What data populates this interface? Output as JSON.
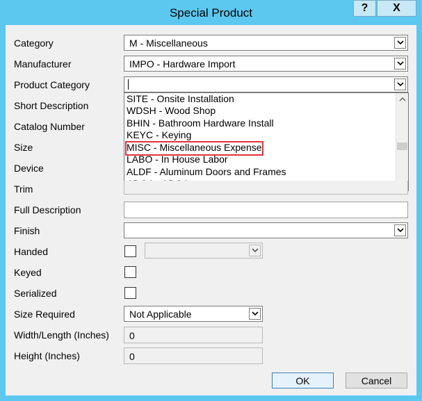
{
  "window": {
    "title": "Special Product",
    "help_glyph": "?",
    "close_glyph": "X"
  },
  "form": {
    "labels": {
      "category": "Category",
      "manufacturer": "Manufacturer",
      "product_category": "Product Category",
      "short_description": "Short Description",
      "catalog_number": "Catalog Number",
      "size": "Size",
      "device": "Device",
      "trim": "Trim",
      "full_description": "Full Description",
      "finish": "Finish",
      "handed": "Handed",
      "keyed": "Keyed",
      "serialized": "Serialized",
      "size_required": "Size Required",
      "width_length": "Width/Length (Inches)",
      "height": "Height (Inches)"
    },
    "values": {
      "category": "M - Miscellaneous",
      "manufacturer": "IMPO - Hardware Import",
      "product_category": "",
      "full_description": "",
      "finish": "",
      "handed_select": "",
      "size_required": "Not Applicable",
      "width_length": "0",
      "height": "0"
    },
    "checkboxes": {
      "handed": false,
      "keyed": false,
      "serialized": false
    }
  },
  "dropdown_list": {
    "items": [
      "SITE - Onsite Installation",
      "WDSH - Wood Shop",
      "BHIN - Bathroom Hardware Install",
      "KEYC - Keying",
      "MISC - Miscellaneous Expense",
      "LABO - In House Labor",
      "ALDF - Aluminum Doors and Frames",
      "ADOA - ADOA"
    ],
    "highlighted_item": "MISC - Miscellaneous Expense"
  },
  "buttons": {
    "ok": "OK",
    "cancel": "Cancel"
  },
  "icons": {
    "dropdown": "chevron-down-icon",
    "scroll_up": "chevron-up-icon",
    "scroll_down": "chevron-down-icon"
  },
  "colors": {
    "titlebar": "#5cc8f0",
    "client": "#f0f0f0",
    "highlight_box": "#e0343a"
  }
}
